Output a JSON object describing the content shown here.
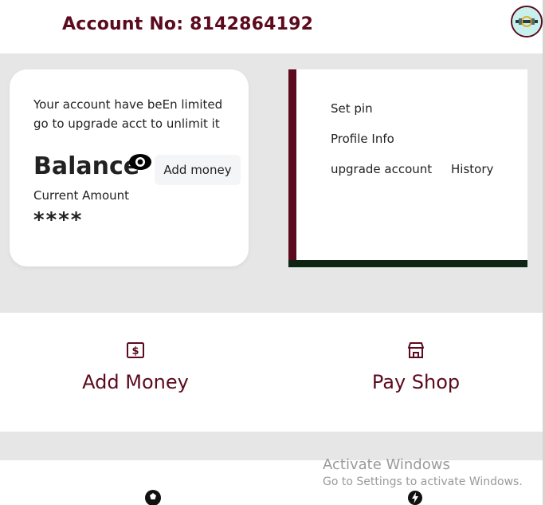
{
  "header": {
    "account_label": "Account No: 8142864192",
    "avatar_icon": "profile-logo-icon"
  },
  "balance_card": {
    "limit_message": "Your account have beEn limited go to upgrade acct to unlimit it",
    "balance_label": "Balance",
    "visibility_icon": "eye-icon",
    "add_money_label": "Add money",
    "current_amount_label": "Current Amount",
    "amount_masked": "****"
  },
  "menu": {
    "set_pin": "Set pin",
    "profile_info": "Profile Info",
    "upgrade_account": "upgrade account",
    "history": "History"
  },
  "actions": [
    {
      "label": "Add Money",
      "icon": "dollar-icon"
    },
    {
      "label": "Pay Shop",
      "icon": "store-icon"
    }
  ],
  "second_row_icons": [
    "soccer-ball-icon",
    "lightning-icon"
  ],
  "watermark": {
    "title": "Activate Windows",
    "subtitle": "Go to Settings to activate Windows."
  },
  "colors": {
    "brand": "#5c0a1d",
    "accent_dark": "#0f2412",
    "background": "#e6e6e6"
  }
}
